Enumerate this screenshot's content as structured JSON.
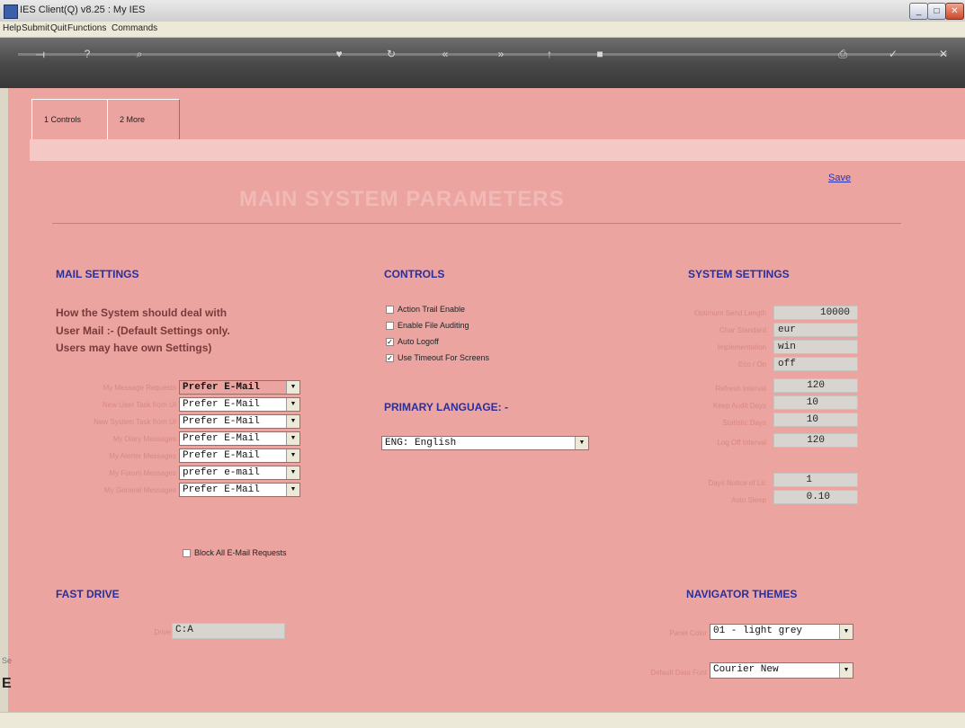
{
  "window": {
    "title": "IES Client(Q) v8.25 : My IES"
  },
  "menu": [
    "Help",
    "Submit",
    "Quit",
    "Functions",
    "Commands"
  ],
  "tabs": [
    {
      "label": "1 Controls"
    },
    {
      "label": "2 More"
    }
  ],
  "page": {
    "title": "MAIN SYSTEM PARAMETERS",
    "save_label": "Save"
  },
  "mail": {
    "heading": "MAIL SETTINGS",
    "intro": [
      "How the System should deal with",
      "User Mail :- (Default Settings only.",
      "Users may have own Settings)"
    ],
    "rows": [
      {
        "value": "Prefer E-Mail"
      },
      {
        "value": "Prefer E-Mail"
      },
      {
        "value": "Prefer E-Mail"
      },
      {
        "value": "Prefer E-Mail"
      },
      {
        "value": "Prefer E-Mail"
      },
      {
        "value": "prefer e-mail"
      },
      {
        "value": "Prefer E-Mail"
      }
    ],
    "block_label": "Block All E-Mail Requests"
  },
  "controls": {
    "heading": "CONTROLS",
    "items": [
      {
        "label": "Action Trail Enable",
        "checked": false
      },
      {
        "label": "Enable File Auditing",
        "checked": false
      },
      {
        "label": "Auto Logoff",
        "checked": true
      },
      {
        "label": "Use Timeout For Screens",
        "checked": true
      }
    ]
  },
  "language": {
    "heading": "PRIMARY LANGUAGE: -",
    "value": "ENG: English"
  },
  "system": {
    "heading": "SYSTEM SETTINGS",
    "values": [
      "10000",
      "eur",
      "win",
      "off",
      "120",
      "10",
      "10",
      "120",
      "1",
      "0.10"
    ]
  },
  "fast_drive": {
    "heading": "FAST DRIVE",
    "value": "C:A"
  },
  "themes": {
    "heading": "NAVIGATOR THEMES",
    "panel_color": "01 - light grey",
    "default_font": "Courier New"
  },
  "colors": {
    "background": "#eba4a0",
    "heading": "#2b2f9a"
  }
}
